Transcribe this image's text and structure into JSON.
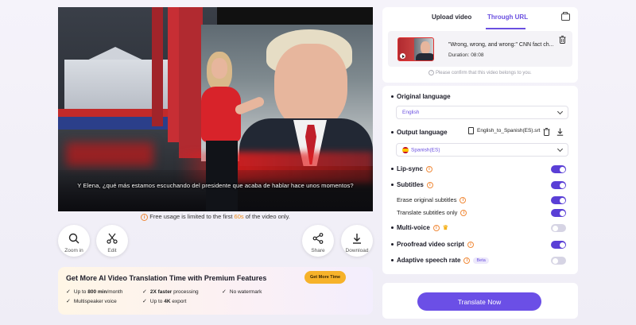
{
  "video": {
    "subtitle": "Y Elena, ¿qué más estamos escuchando del presidente que acaba de hablar hace unos momentos?",
    "free_note_prefix": "Free usage is limited to the first ",
    "free_note_highlight": "60s",
    "free_note_suffix": " of the video only."
  },
  "tools": {
    "zoom": "Zoom in",
    "edit": "Edit",
    "share": "Share",
    "download": "Download"
  },
  "promo": {
    "title": "Get More AI Video Translation Time with Premium Features",
    "button": "Get More Time",
    "features": {
      "f1_pre": "Up to ",
      "f1_bold": "800 min",
      "f1_post": "/month",
      "f2_bold": "2X faster",
      "f2_post": " processing",
      "f3": "No watermark",
      "f4": "Multispeaker voice",
      "f5_pre": "Up to ",
      "f5_bold": "4K",
      "f5_post": " export"
    }
  },
  "source": {
    "tabs": [
      "Upload video",
      "Through URL"
    ],
    "active_tab": "Through URL",
    "video_title": "\"Wrong, wrong, and wrong:\" CNN fact ch...",
    "duration_label": "Duration: ",
    "duration": "08:08",
    "confirm": "Please confirm that this video belongs to you."
  },
  "settings": {
    "original_language_label": "Original language",
    "original_language": "English",
    "output_language_label": "Output language",
    "srt_file": "English_to_Spanish(ES).srt",
    "output_language": "Spanish(ES)",
    "lip_sync": "Lip-sync",
    "subtitles": "Subtitles",
    "erase_subtitles": "Erase original subtitles",
    "translate_subtitles": "Translate subtitles only",
    "multi_voice": "Multi-voice",
    "proofread": "Proofread video script",
    "adaptive_rate": "Adaptive speech rate",
    "beta": "Beta",
    "toggles": {
      "lip_sync": true,
      "subtitles": true,
      "erase_subtitles": true,
      "translate_subtitles": true,
      "multi_voice": false,
      "proofread": true,
      "adaptive_rate": false
    }
  },
  "action": {
    "translate_button": "Translate Now"
  },
  "colors": {
    "accent": "#6b4fe6",
    "highlight": "#f08a18",
    "promo_button": "#f6b22a"
  },
  "icons": [
    "zoom-in-icon",
    "scissors-icon",
    "share-icon",
    "download-icon",
    "folder-icon",
    "trash-icon",
    "info-icon",
    "crown-icon",
    "document-icon"
  ]
}
